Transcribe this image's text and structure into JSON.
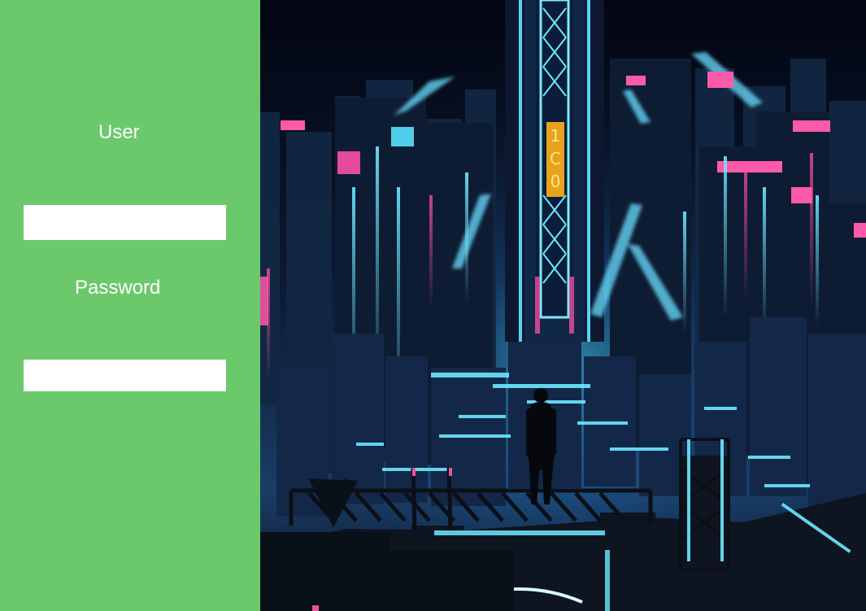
{
  "login": {
    "user_label": "User",
    "password_label": "Password",
    "user_value": "",
    "password_value": "",
    "accent_color": "#6cc96b"
  },
  "hero": {
    "icon": "cyberpunk-city-illustration"
  }
}
